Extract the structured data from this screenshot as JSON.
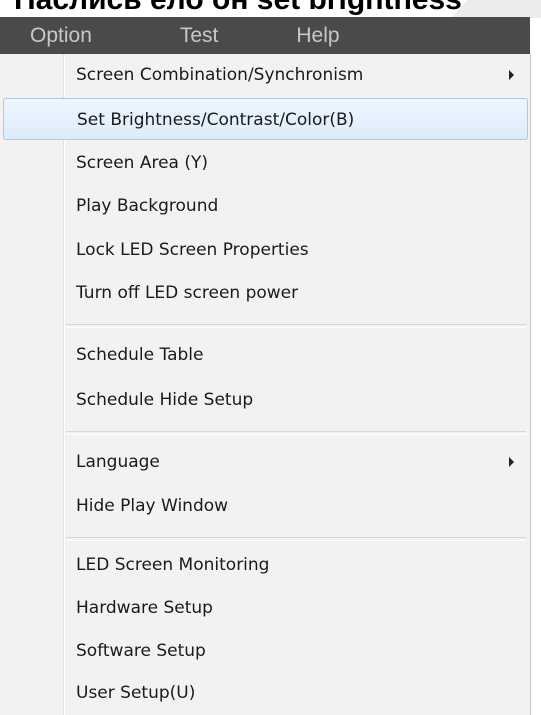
{
  "caption": "Наслись ело он set brightness",
  "menubar": {
    "items": [
      "Option",
      "Test",
      "Help"
    ]
  },
  "menu": {
    "items": [
      {
        "label": "Screen Combination/Synchronism",
        "submenu": true
      },
      {
        "label": "Set Brightness/Contrast/Color(B)",
        "highlighted": true
      },
      {
        "label": "Screen Area (Y)"
      },
      {
        "label": "Play Background"
      },
      {
        "label": "Lock LED Screen Properties"
      },
      {
        "label": "Turn off LED screen power"
      },
      {
        "label": "Schedule Table"
      },
      {
        "label": "Schedule Hide Setup"
      },
      {
        "label": "Language",
        "submenu": true
      },
      {
        "label": "Hide Play Window"
      },
      {
        "label": "LED Screen Monitoring"
      },
      {
        "label": "Hardware Setup"
      },
      {
        "label": "Software Setup"
      },
      {
        "label": "User Setup(U)"
      }
    ]
  },
  "colors": {
    "menubar_bg": "#4a4a4a",
    "menubar_text": "#c8c8c8",
    "menu_bg": "#f2f2f2",
    "highlight_border": "#a8cbe8",
    "highlight_bg": "#dcecfb"
  }
}
